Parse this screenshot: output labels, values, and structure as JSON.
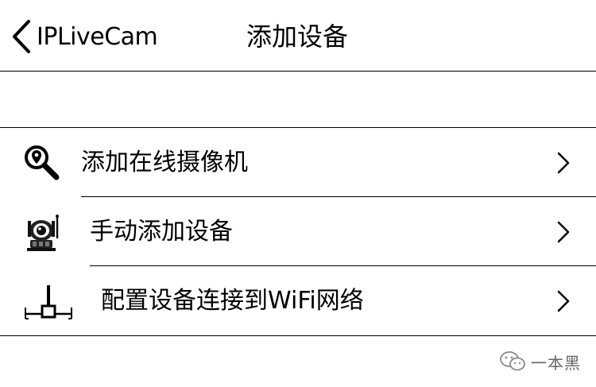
{
  "navbar": {
    "back_label": "IPLiveCam",
    "title": "添加设备"
  },
  "menu": {
    "items": [
      {
        "label": "添加在线摄像机",
        "icon": "search-location-icon"
      },
      {
        "label": "手动添加设备",
        "icon": "camera-icon"
      },
      {
        "label": "配置设备连接到WiFi网络",
        "icon": "network-connection-icon"
      }
    ]
  },
  "watermark": {
    "text": "一本黑"
  }
}
